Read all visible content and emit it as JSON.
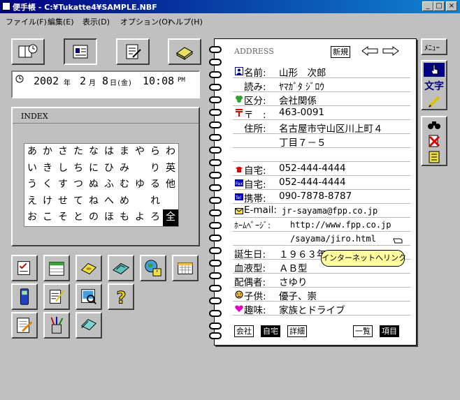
{
  "window": {
    "title": "便手帳 - C:¥Tukatte4¥SAMPLE.NBF"
  },
  "menu": [
    "ファイル(F)",
    "編集(E)",
    "表示(D)",
    "オプション(O)",
    "ヘルプ(H)"
  ],
  "clock": {
    "year": "2002",
    "year_unit": "年",
    "month": "2",
    "month_unit": "月",
    "day": "8",
    "day_unit": "日",
    "weekday": "(金)",
    "time": "10:08",
    "ampm": "PM"
  },
  "index": {
    "header": "INDEX",
    "rows": [
      [
        "あ",
        "か",
        "さ",
        "た",
        "な",
        "は",
        "ま",
        "や",
        "ら",
        "わ"
      ],
      [
        "い",
        "き",
        "し",
        "ち",
        "に",
        "ひ",
        "み",
        "",
        "り",
        "英"
      ],
      [
        "う",
        "く",
        "す",
        "つ",
        "ぬ",
        "ふ",
        "む",
        "ゆ",
        "る",
        "他"
      ],
      [
        "え",
        "け",
        "せ",
        "て",
        "ね",
        "へ",
        "め",
        "",
        "れ",
        ""
      ],
      [
        "お",
        "こ",
        "そ",
        "と",
        "の",
        "ほ",
        "も",
        "よ",
        "ろ",
        "全"
      ]
    ],
    "selected": "全"
  },
  "address": {
    "header": "ADDRESS",
    "new_button": "新規",
    "fields": [
      {
        "icon": "name-icon",
        "label": "名前:",
        "value": "山形　次郎"
      },
      {
        "icon": "",
        "label": "読み:",
        "value": "ﾔﾏｶﾞﾀ ｼﾞﾛｳ"
      },
      {
        "icon": "category-icon",
        "label": "区分:",
        "value": "会社関係"
      },
      {
        "icon": "postal-icon",
        "label": "〒　:",
        "value": "463-0091"
      },
      {
        "icon": "",
        "label": "住所:",
        "value": "名古屋市守山区川上町４"
      },
      {
        "icon": "",
        "label": "",
        "value": "丁目７－５"
      },
      {
        "icon": "",
        "label": "",
        "value": ""
      },
      {
        "icon": "phone-icon",
        "label": "自宅:",
        "value": "052-444-4444"
      },
      {
        "icon": "fax-icon",
        "label": "自宅:",
        "value": "052-444-4444"
      },
      {
        "icon": "mobile-icon",
        "label": "携帯:",
        "value": "090-7878-8787"
      },
      {
        "icon": "mail-icon",
        "label": "E-mail:",
        "value": "jr-sayama@fpp.co.jp"
      },
      {
        "icon": "",
        "label": "ﾎｰﾑﾍﾟｰｼﾞ:",
        "value": "http://www.fpp.co.jp"
      },
      {
        "icon": "",
        "label": "",
        "value": "/sayama/jiro.html"
      },
      {
        "icon": "",
        "label": "誕生日:",
        "value": "１９６３年"
      },
      {
        "icon": "",
        "label": "血液型:",
        "value": "ＡＢ型"
      },
      {
        "icon": "",
        "label": "配偶者:",
        "value": "さゆり"
      },
      {
        "icon": "child-icon",
        "label": "子供:",
        "value": "優子、崇"
      },
      {
        "icon": "heart-icon",
        "label": "趣味:",
        "value": "家族とドライブ"
      }
    ],
    "tooltip": "インターネットへリンク",
    "bottom_left": [
      "会社",
      "自宅",
      "詳細"
    ],
    "bottom_left_selected": "自宅",
    "bottom_right": [
      "一覧",
      "項目"
    ],
    "bottom_right_selected": "項目"
  },
  "right_toolbar": {
    "menu_label": "ﾒﾆｭｰ",
    "text_label": "文字"
  }
}
